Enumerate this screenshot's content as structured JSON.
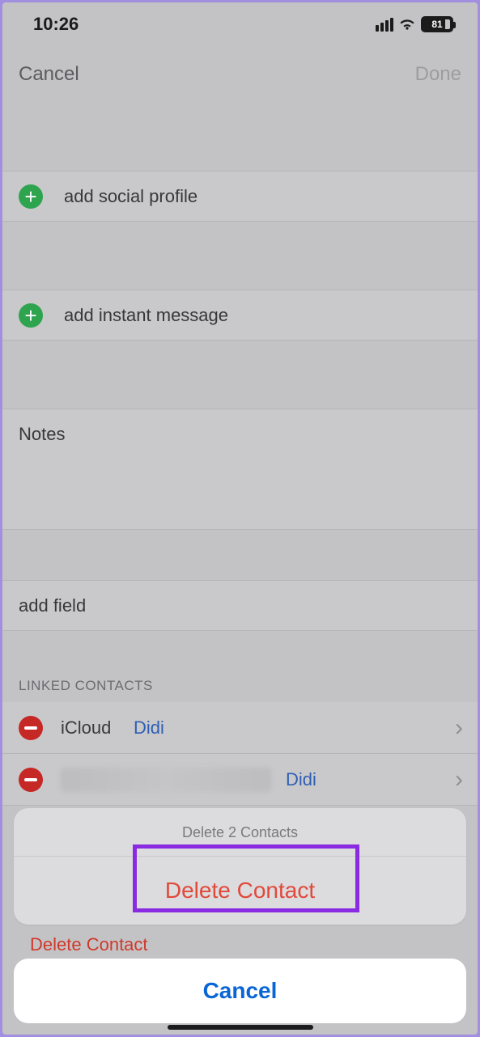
{
  "status": {
    "time": "10:26",
    "battery": "81"
  },
  "nav": {
    "cancel": "Cancel",
    "done": "Done"
  },
  "rows": {
    "addSocial": "add social profile",
    "addInstant": "add instant message",
    "notesLabel": "Notes",
    "addField": "add field"
  },
  "linked": {
    "header": "LINKED CONTACTS",
    "items": [
      {
        "source": "iCloud",
        "name": "Didi"
      },
      {
        "source": "",
        "name": "Didi"
      }
    ]
  },
  "deletePeek": "Delete Contact",
  "sheet": {
    "title": "Delete 2 Contacts",
    "delete": "Delete Contact",
    "cancel": "Cancel"
  }
}
